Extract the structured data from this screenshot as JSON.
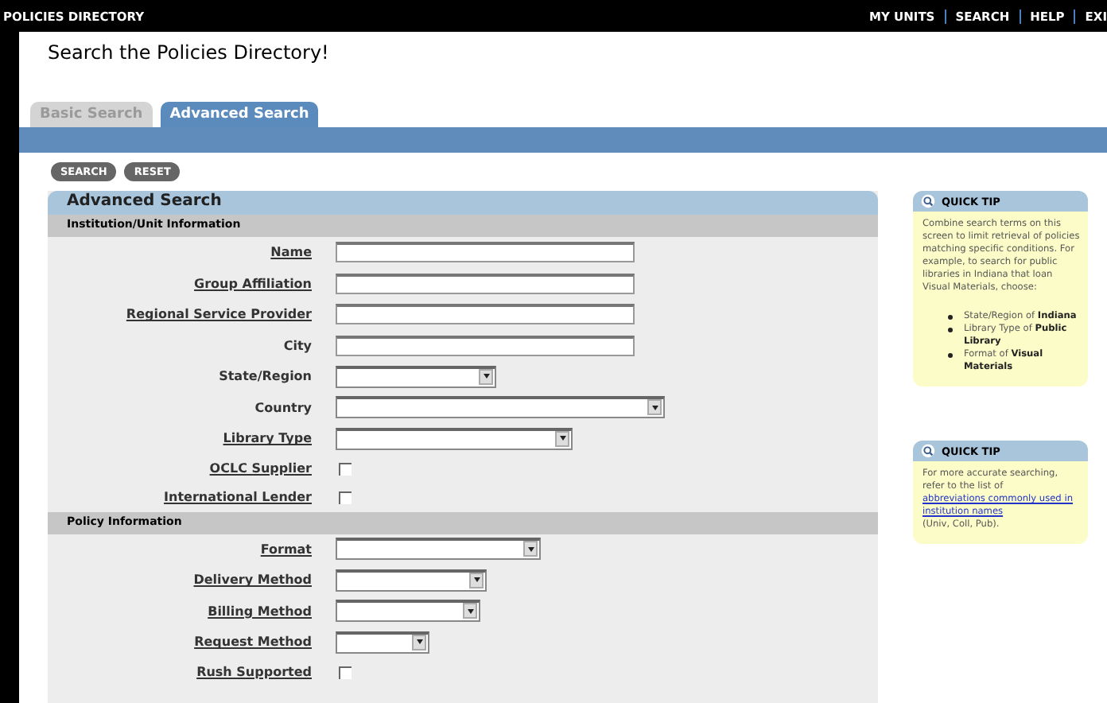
{
  "top_bar": {
    "title": "POLICIES DIRECTORY",
    "links": [
      "MY UNITS",
      "SEARCH",
      "HELP",
      "EXI"
    ]
  },
  "page_title": "Search the Policies Directory!",
  "tabs": [
    {
      "label": "Basic Search",
      "selected": false
    },
    {
      "label": "Advanced Search",
      "selected": true
    }
  ],
  "buttons": [
    "SEARCH",
    "RESET"
  ],
  "panel": {
    "title": "Advanced Search",
    "sections": [
      {
        "title": "Institution/Unit Information",
        "fields": [
          {
            "label": "Name",
            "link": true,
            "kind": "text"
          },
          {
            "label": "Group Affiliation",
            "link": true,
            "kind": "text"
          },
          {
            "label": "Regional Service Provider",
            "link": true,
            "kind": "text"
          },
          {
            "label": "City",
            "link": false,
            "kind": "text"
          },
          {
            "label": "State/Region",
            "link": false,
            "kind": "select"
          },
          {
            "label": "Country",
            "link": false,
            "kind": "select"
          },
          {
            "label": "Library Type",
            "link": true,
            "kind": "select"
          },
          {
            "label": "OCLC Supplier",
            "link": true,
            "kind": "checkbox",
            "checked": false
          },
          {
            "label": "International Lender",
            "link": true,
            "kind": "checkbox",
            "checked": false
          }
        ]
      },
      {
        "title": "Policy Information",
        "fields": [
          {
            "label": "Format",
            "link": true,
            "kind": "select"
          },
          {
            "label": "Delivery Method",
            "link": true,
            "kind": "select"
          },
          {
            "label": "Billing Method",
            "link": true,
            "kind": "select"
          },
          {
            "label": "Request Method",
            "link": true,
            "kind": "select"
          },
          {
            "label": "Rush Supported",
            "link": true,
            "kind": "checkbox",
            "checked": false
          }
        ]
      }
    ]
  },
  "tips": [
    {
      "title": "QUICK TIP",
      "text": "Combine search terms on this screen to limit retrieval of policies matching specific conditions. For example, to search for public libraries in Indiana that loan Visual Materials, choose:",
      "bullets": [
        "State/Region of **Indiana**",
        "Library Type of **Public Library**",
        "Format of **Visual Materials**"
      ]
    },
    {
      "title": "QUICK TIP",
      "text": "For more accurate searching, refer to the list of",
      "link": "abbreviations commonly used in institution names",
      "after": "(Univ, Coll, Pub)."
    }
  ]
}
